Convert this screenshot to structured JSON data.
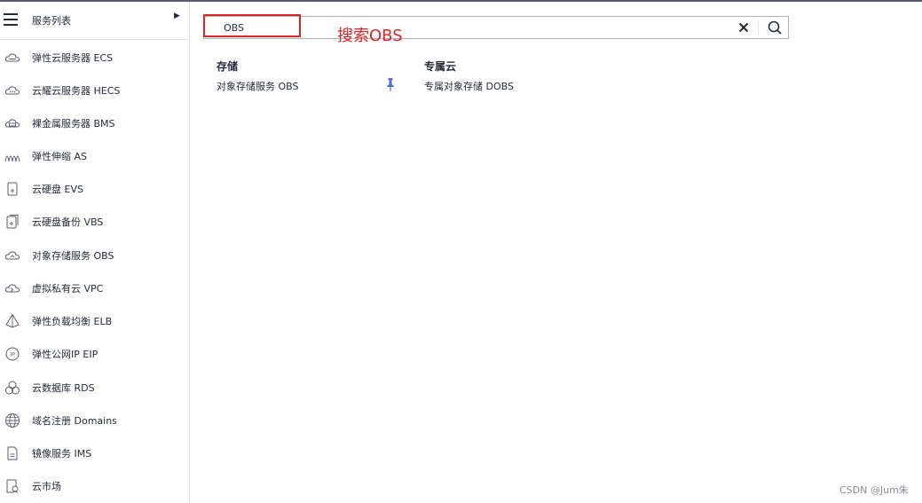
{
  "sidebar": {
    "title": "服务列表",
    "items": [
      {
        "label": "弹性云服务器 ECS",
        "icon": "cloud-server-icon"
      },
      {
        "label": "云耀云服务器 HECS",
        "icon": "cloud-dots-icon"
      },
      {
        "label": "裸金属服务器 BMS",
        "icon": "bare-metal-icon"
      },
      {
        "label": "弹性伸缩 AS",
        "icon": "auto-scaling-icon"
      },
      {
        "label": "云硬盘 EVS",
        "icon": "disk-icon"
      },
      {
        "label": "云硬盘备份 VBS",
        "icon": "disk-backup-icon"
      },
      {
        "label": "对象存储服务 OBS",
        "icon": "object-storage-icon"
      },
      {
        "label": "虚拟私有云 VPC",
        "icon": "vpc-cloud-icon"
      },
      {
        "label": "弹性负载均衡 ELB",
        "icon": "load-balancer-icon"
      },
      {
        "label": "弹性公网IP EIP",
        "icon": "ip-icon"
      },
      {
        "label": "云数据库 RDS",
        "icon": "database-icon"
      },
      {
        "label": "域名注册 Domains",
        "icon": "globe-icon"
      },
      {
        "label": "镜像服务 IMS",
        "icon": "image-file-icon"
      },
      {
        "label": "云市场",
        "icon": "marketplace-icon"
      }
    ]
  },
  "search": {
    "value": "OBS",
    "annotation": "搜索OBS"
  },
  "results": [
    {
      "category": "存储",
      "items": [
        "对象存储服务 OBS"
      ]
    },
    {
      "category": "专属云",
      "items": [
        "专属对象存储 DOBS"
      ]
    }
  ],
  "colors": {
    "accent": "#526ecc",
    "annotation": "#e02424",
    "text": "#252b3a",
    "border": "#adb0b8"
  },
  "watermark": "CSDN @Jum朱"
}
